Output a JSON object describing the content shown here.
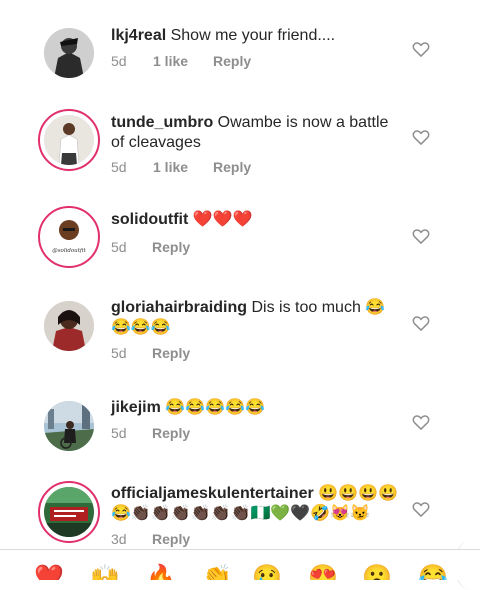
{
  "comments": [
    {
      "username": "lkj4real",
      "text": "Show me your friend....",
      "time": "5d",
      "likes": "1 like",
      "reply": "Reply"
    },
    {
      "username": "tunde_umbro",
      "text": "Owambe is now a battle of cleavages",
      "time": "5d",
      "likes": "1 like",
      "reply": "Reply"
    },
    {
      "username": "solidoutfit",
      "text": "❤️❤️❤️",
      "time": "5d",
      "reply": "Reply",
      "avatar_text": "@solidoutfit"
    },
    {
      "username": "gloriahairbraiding",
      "text": "Dis is too much 😂😂😂😂",
      "time": "5d",
      "reply": "Reply"
    },
    {
      "username": "jikejim",
      "text": "😂😂😂😂😂",
      "time": "5d",
      "reply": "Reply"
    },
    {
      "username": "officialjameskulentertainer",
      "text": "😃😃😃😃😂👏🏿👏🏿👏🏿👏🏿👏🏿👏🏿🇳🇬💚🖤🤣😻😼",
      "time": "3d",
      "reply": "Reply"
    }
  ],
  "quick_reactions": [
    "❤️",
    "🙌",
    "🔥",
    "👏",
    "😢",
    "😍",
    "😮",
    "😂"
  ],
  "colors": {
    "ring": "#e1306c",
    "heart_red": "#ed4956",
    "meta": "#8e8e8e"
  }
}
